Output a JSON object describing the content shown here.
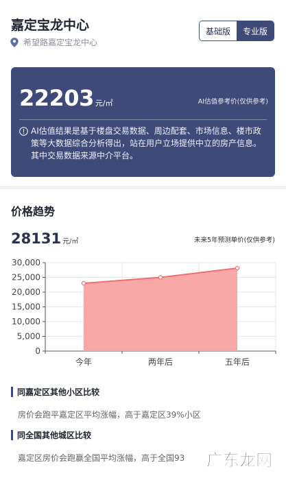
{
  "header": {
    "title": "嘉定宝龙中心",
    "location": "希望路嘉定宝龙中心",
    "version_basic": "基础版",
    "version_pro": "专业版"
  },
  "ai_card": {
    "price": "22203",
    "unit": "元/㎡",
    "reference": "AI估值参考价(仅供参考)",
    "description": "AI估值结果是基于楼盘交易数据、周边配套、市场信息、楼市政策等大数据综合分析得出，站在用户立场提供中立的房产信息。其中交易数据来源中介平台。"
  },
  "trend": {
    "title": "价格趋势",
    "price": "28131",
    "unit": "元/㎡",
    "reference": "未来5年预测单价(仅供参考)"
  },
  "chart_data": {
    "type": "area",
    "categories": [
      "今年",
      "两年后",
      "五年后"
    ],
    "series": [
      {
        "values": [
          23000,
          25000,
          28131
        ]
      }
    ],
    "yticks": [
      "0",
      "5,000",
      "10,000",
      "15,000",
      "20,000",
      "25,000",
      "30,000"
    ],
    "ylim": [
      0,
      30000
    ],
    "grid": true,
    "colors": {
      "line": "#ef6f6f",
      "fill": "#f9a3a3",
      "point_fill": "#ffffff",
      "axis": "#555555",
      "grid": "#e6e6e6"
    }
  },
  "compare_district": {
    "heading": "同嘉定区其他小区比较",
    "text": "房价会跑平嘉定区平均涨幅，高于嘉定区39%小区"
  },
  "compare_national": {
    "heading": "同全国其他城区比较",
    "text": "嘉定区房价会跑赢全国平均涨幅，高于全国93"
  },
  "watermark": {
    "text": "广东龙网",
    "icon": "watermark-logo"
  },
  "colors": {
    "brand": "#3e4a78",
    "page_bg": "#ffffff",
    "gap": "#f0f1f4"
  }
}
